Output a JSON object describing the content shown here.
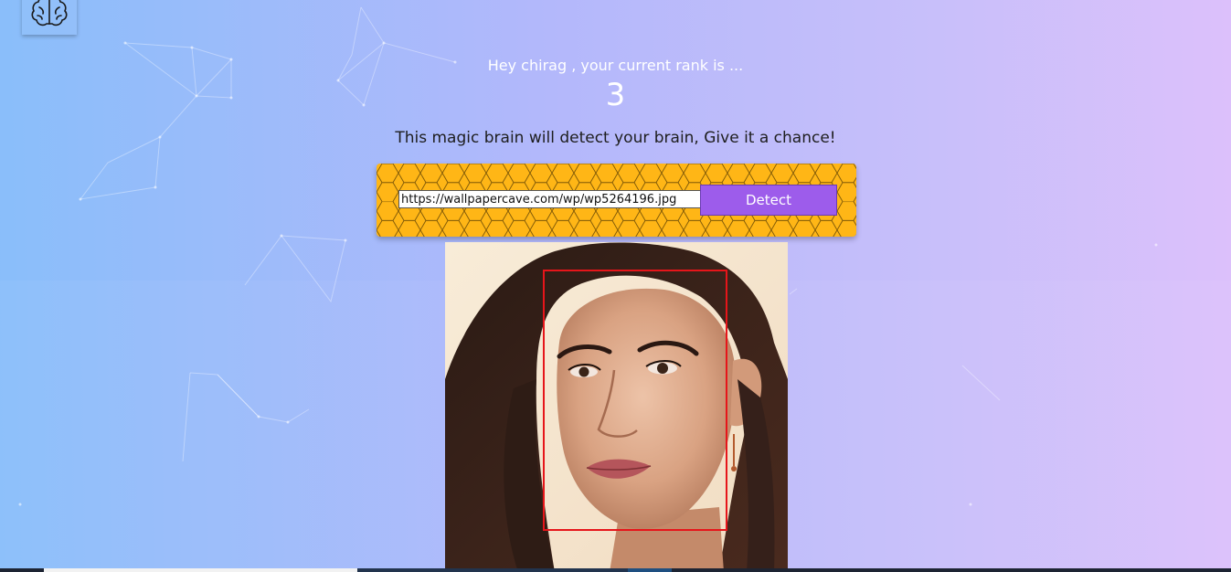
{
  "header": {
    "logo_icon": "brain-icon",
    "greeting": "Hey chirag , your current rank is ...",
    "rank": "3"
  },
  "main": {
    "tagline": "This magic brain will detect your brain, Give it a chance!",
    "form": {
      "url_value": "https://wallpapercave.com/wp/wp5264196.jpg",
      "url_placeholder": "",
      "detect_label": "Detect"
    },
    "result": {
      "image_alt": "face-detection-result",
      "box_color": "#e6151a"
    }
  },
  "colors": {
    "panel": "#ffb616",
    "button": "#9d5ceb",
    "gradient_start": "#89befa",
    "gradient_end": "#dcc0fb"
  }
}
